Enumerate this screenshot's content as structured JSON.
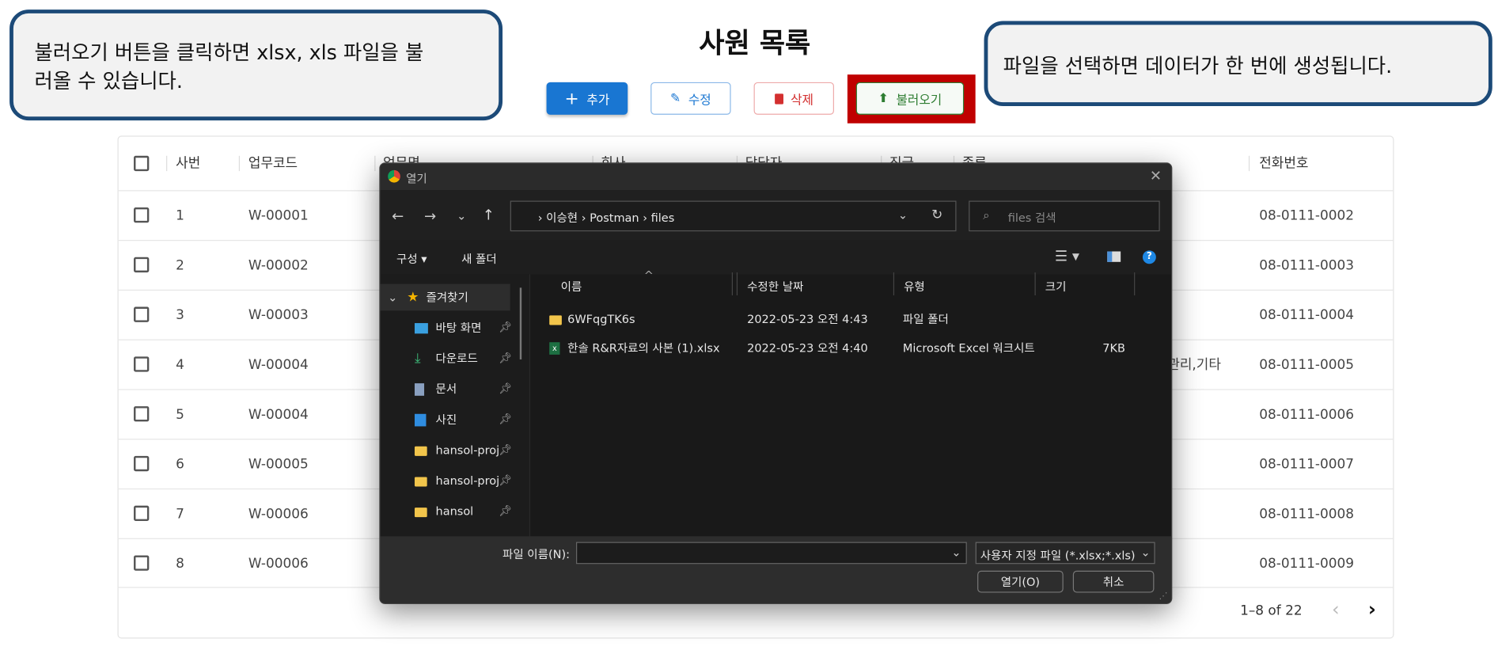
{
  "callouts": {
    "left_line1": "불러오기 버튼을 클릭하면 xlsx, xls 파일을 불",
    "left_line2": "러올 수 있습니다.",
    "right": "파일을 선택하면 데이터가 한 번에 생성됩니다."
  },
  "page": {
    "title": "사원 목록"
  },
  "toolbar": {
    "add": "추가",
    "edit": "수정",
    "delete": "삭제",
    "import": "불러오기"
  },
  "colors": {
    "primary": "#1976d2",
    "danger": "#d32f2f",
    "success": "#2e7d32",
    "highlight": "#c00000",
    "callout_border": "#1c4a78"
  },
  "table": {
    "columns": [
      "사번",
      "업무코드",
      "업무명",
      "회사",
      "담당자",
      "직급",
      "종류",
      "전화번호"
    ],
    "rows": [
      {
        "id": "1",
        "code": "W-00001",
        "type": "",
        "phone": "08-0111-0002"
      },
      {
        "id": "2",
        "code": "W-00002",
        "type": "",
        "phone": "08-0111-0003"
      },
      {
        "id": "3",
        "code": "W-00003",
        "type": "",
        "phone": "08-0111-0004"
      },
      {
        "id": "4",
        "code": "W-00004",
        "type": "관리,기타",
        "phone": "08-0111-0005"
      },
      {
        "id": "5",
        "code": "W-00004",
        "type": "",
        "phone": "08-0111-0006"
      },
      {
        "id": "6",
        "code": "W-00005",
        "type": "",
        "phone": "08-0111-0007"
      },
      {
        "id": "7",
        "code": "W-00006",
        "type": "",
        "phone": "08-0111-0008"
      },
      {
        "id": "8",
        "code": "W-00006",
        "type": "",
        "phone": "08-0111-0009"
      }
    ],
    "pagination": "1–8 of 22"
  },
  "dialog": {
    "title": "열기",
    "path": [
      "이승현",
      "Postman",
      "files"
    ],
    "search_placeholder": "files 검색",
    "organize": "구성 ▾",
    "new_folder": "새 폴더",
    "sidebar": [
      "즐겨찾기",
      "바탕 화면",
      "다운로드",
      "문서",
      "사진",
      "hansol-proje",
      "hansol-proje",
      "hansol"
    ],
    "columns": [
      "이름",
      "수정한 날짜",
      "유형",
      "크기"
    ],
    "files": [
      {
        "name": "6WFqgTK6s",
        "date": "2022-05-23 오전 4:43",
        "type": "파일 폴더",
        "size": ""
      },
      {
        "name": "한솔 R&R자료의 사본 (1).xlsx",
        "date": "2022-05-23 오전 4:40",
        "type": "Microsoft Excel 워크시트",
        "size": "7KB"
      }
    ],
    "filename_label": "파일 이름(N):",
    "filename_value": "",
    "filter": "사용자 지정 파일 (*.xlsx;*.xls)",
    "open": "열기(O)",
    "cancel": "취소"
  }
}
